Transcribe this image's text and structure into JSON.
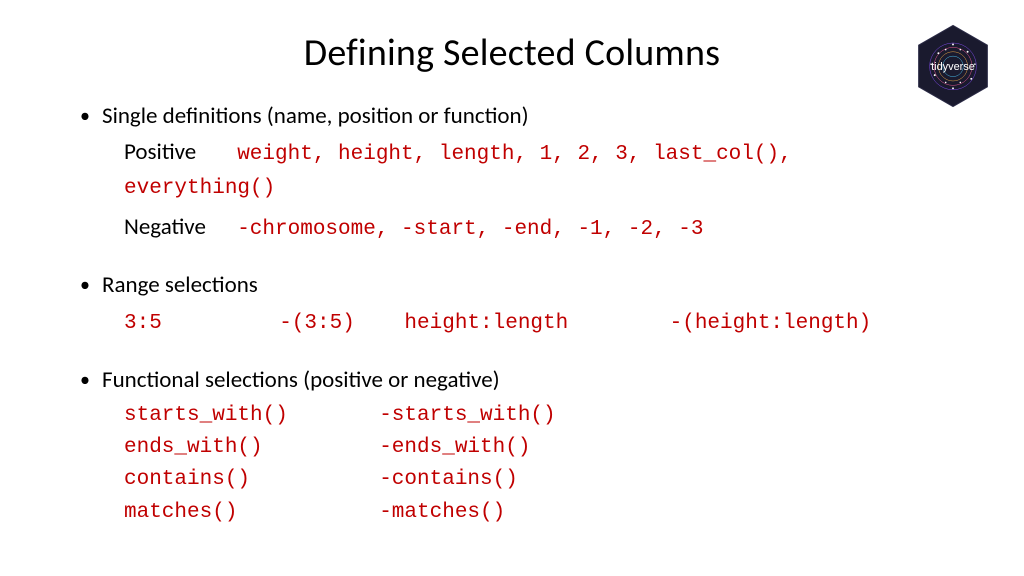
{
  "logo_label": "tidyverse",
  "title": "Defining Selected Columns",
  "bullets": {
    "b1": {
      "heading": "Single definitions (name, position or function)",
      "pos_label": "Positive",
      "pos_code": "weight, height, length, 1, 2, 3, last_col(), everything()",
      "neg_label": "Negative",
      "neg_code": "-chromosome, -start, -end, -1, -2, -3"
    },
    "b2": {
      "heading": "Range selections",
      "r1": "3:5",
      "r2": "-(3:5)",
      "r3": "height:length",
      "r4": "-(height:length)"
    },
    "b3": {
      "heading": "Functional selections (positive or negative)",
      "rows": {
        "a1": "starts_with()",
        "a2": "-starts_with()",
        "b1": "ends_with()",
        "b2": "-ends_with()",
        "c1": "contains()",
        "c2": "-contains()",
        "d1": "matches()",
        "d2": "-matches()"
      }
    }
  }
}
